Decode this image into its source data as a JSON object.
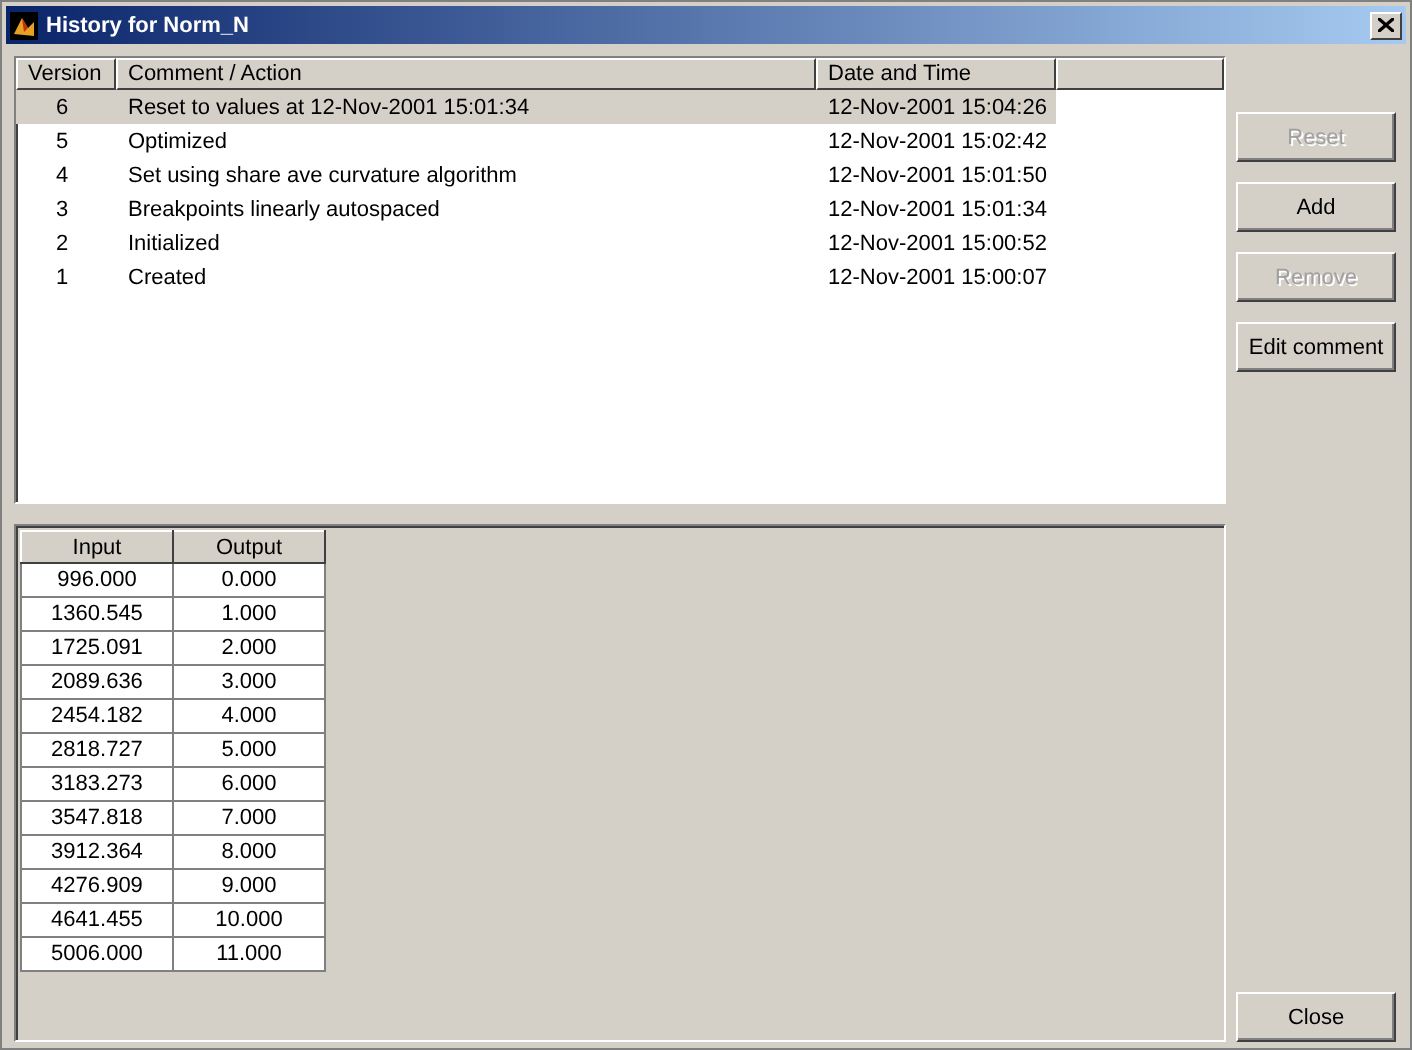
{
  "window": {
    "title": "History for Norm_N"
  },
  "history": {
    "columns": [
      "Version",
      "Comment / Action",
      "Date and Time"
    ],
    "rows": [
      {
        "version": "6",
        "comment": "Reset to values at 12-Nov-2001 15:01:34",
        "date": "12-Nov-2001 15:04:26",
        "selected": true
      },
      {
        "version": "5",
        "comment": "Optimized",
        "date": "12-Nov-2001 15:02:42",
        "selected": false
      },
      {
        "version": "4",
        "comment": "Set using share ave curvature algorithm",
        "date": "12-Nov-2001 15:01:50",
        "selected": false
      },
      {
        "version": "3",
        "comment": "Breakpoints linearly autospaced",
        "date": "12-Nov-2001 15:01:34",
        "selected": false
      },
      {
        "version": "2",
        "comment": "Initialized",
        "date": "12-Nov-2001 15:00:52",
        "selected": false
      },
      {
        "version": "1",
        "comment": "Created",
        "date": "12-Nov-2001 15:00:07",
        "selected": false
      }
    ]
  },
  "buttons": [
    {
      "label": "Reset",
      "disabled": true
    },
    {
      "label": "Add",
      "disabled": false
    },
    {
      "label": "Remove",
      "disabled": true
    },
    {
      "label": "Edit comment",
      "disabled": false
    }
  ],
  "table": {
    "columns": [
      "Input",
      "Output"
    ],
    "rows": [
      [
        "996.000",
        "0.000"
      ],
      [
        "1360.545",
        "1.000"
      ],
      [
        "1725.091",
        "2.000"
      ],
      [
        "2089.636",
        "3.000"
      ],
      [
        "2454.182",
        "4.000"
      ],
      [
        "2818.727",
        "5.000"
      ],
      [
        "3183.273",
        "6.000"
      ],
      [
        "3547.818",
        "7.000"
      ],
      [
        "3912.364",
        "8.000"
      ],
      [
        "4276.909",
        "9.000"
      ],
      [
        "4641.455",
        "10.000"
      ],
      [
        "5006.000",
        "11.000"
      ]
    ]
  },
  "close_button": {
    "label": "Close"
  }
}
